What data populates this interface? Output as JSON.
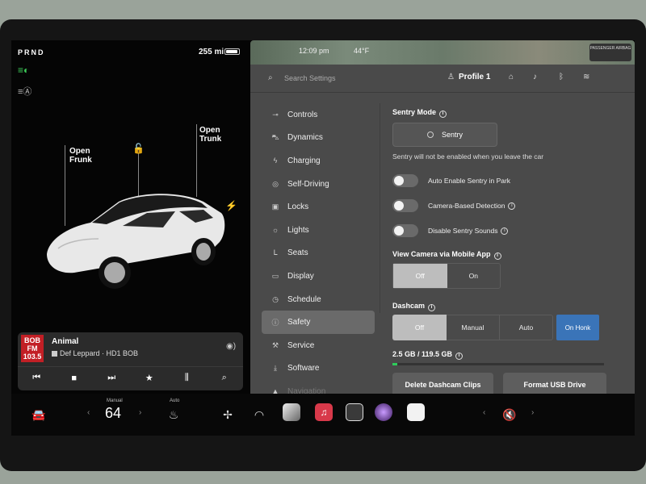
{
  "left": {
    "gear": "PRND",
    "range": "255 mi",
    "labels": {
      "frunk": "Open\nFrunk",
      "trunk": "Open\nTrunk"
    }
  },
  "media": {
    "station_logo": "BOB\nFM\n103.5",
    "song": "Animal",
    "artist": "Def Leppard · HD1 BOB"
  },
  "mapbar": {
    "time": "12:09 pm",
    "temp": "44°F",
    "airbag_label": "PASSENGER AIRBAG"
  },
  "topbar": {
    "search_placeholder": "Search Settings",
    "profile": "Profile 1"
  },
  "nav": [
    {
      "label": "Controls",
      "icon": "toggle-icon"
    },
    {
      "label": "Dynamics",
      "icon": "car-icon"
    },
    {
      "label": "Charging",
      "icon": "bolt-icon"
    },
    {
      "label": "Self-Driving",
      "icon": "steering-wheel-icon"
    },
    {
      "label": "Locks",
      "icon": "lock-icon"
    },
    {
      "label": "Lights",
      "icon": "light-icon"
    },
    {
      "label": "Seats",
      "icon": "seat-icon"
    },
    {
      "label": "Display",
      "icon": "display-icon"
    },
    {
      "label": "Schedule",
      "icon": "clock-icon"
    },
    {
      "label": "Safety",
      "icon": "info-icon",
      "active": true
    },
    {
      "label": "Service",
      "icon": "wrench-icon"
    },
    {
      "label": "Software",
      "icon": "download-icon"
    },
    {
      "label": "Navigation",
      "icon": "navigation-icon"
    }
  ],
  "safety": {
    "sentry_heading": "Sentry Mode",
    "sentry_button": "Sentry",
    "sentry_note": "Sentry will not be enabled when you leave the car",
    "toggles": [
      "Auto Enable Sentry in Park",
      "Camera-Based Detection",
      "Disable Sentry Sounds"
    ],
    "view_camera_heading": "View Camera via Mobile App",
    "view_camera_options": [
      "Off",
      "On"
    ],
    "view_camera_selected": "Off",
    "dashcam_heading": "Dashcam",
    "dashcam_options": [
      "Off",
      "Manual",
      "Auto"
    ],
    "dashcam_selected": "Off",
    "dashcam_onhonk": "On Honk",
    "storage": "2.5 GB / 119.5 GB",
    "storage_fraction": 0.021,
    "delete_button": "Delete Dashcam Clips",
    "format_button": "Format USB Drive"
  },
  "dock": {
    "climate_mode": "Manual",
    "temperature": "64",
    "seat_mode": "Auto"
  },
  "colors": {
    "accent_blue": "#3a74b8",
    "headlight_green": "#3ecf5a",
    "storage_green": "#2ecc5a"
  }
}
